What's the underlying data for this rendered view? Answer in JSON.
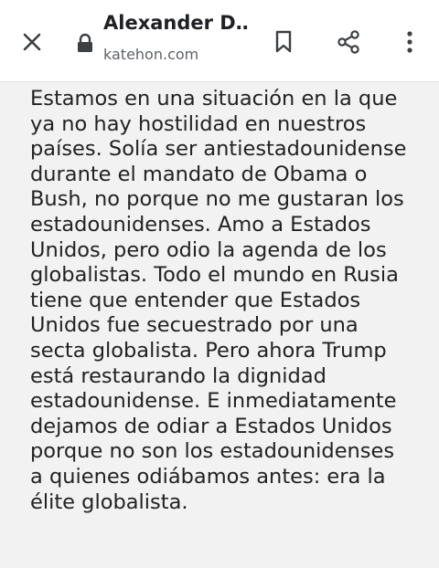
{
  "header": {
    "title": "Alexander D…",
    "domain": "katehon.com",
    "icons": {
      "close": "close-icon",
      "lock": "lock-icon",
      "bookmark": "bookmark-icon",
      "share": "share-icon",
      "more": "more-vert-icon"
    }
  },
  "article": {
    "lines": [
      "Estamos en una situación en la que",
      "ya no hay hostilidad en nuestros",
      "países. Solía ser antiestadounidense",
      "durante el mandato de Obama o",
      "Bush, no porque no me gustaran los",
      "estadounidenses. Amo a Estados",
      "Unidos, pero odio la agenda de los",
      "globalistas. Todo el mundo en Rusia",
      "tiene que entender que Estados",
      "Unidos fue secuestrado por una",
      "secta globalista. Pero ahora Trump",
      "está restaurando la dignidad",
      "estadounidense. E inmediatamente",
      "dejamos de odiar a Estados Unidos",
      "porque no son los estadounidenses",
      "a quienes odiábamos antes: era la",
      "élite globalista."
    ]
  },
  "colors": {
    "background": "#f2f2f2",
    "header_bg": "#ffffff",
    "icon": "#3c4043",
    "text": "#222222"
  }
}
